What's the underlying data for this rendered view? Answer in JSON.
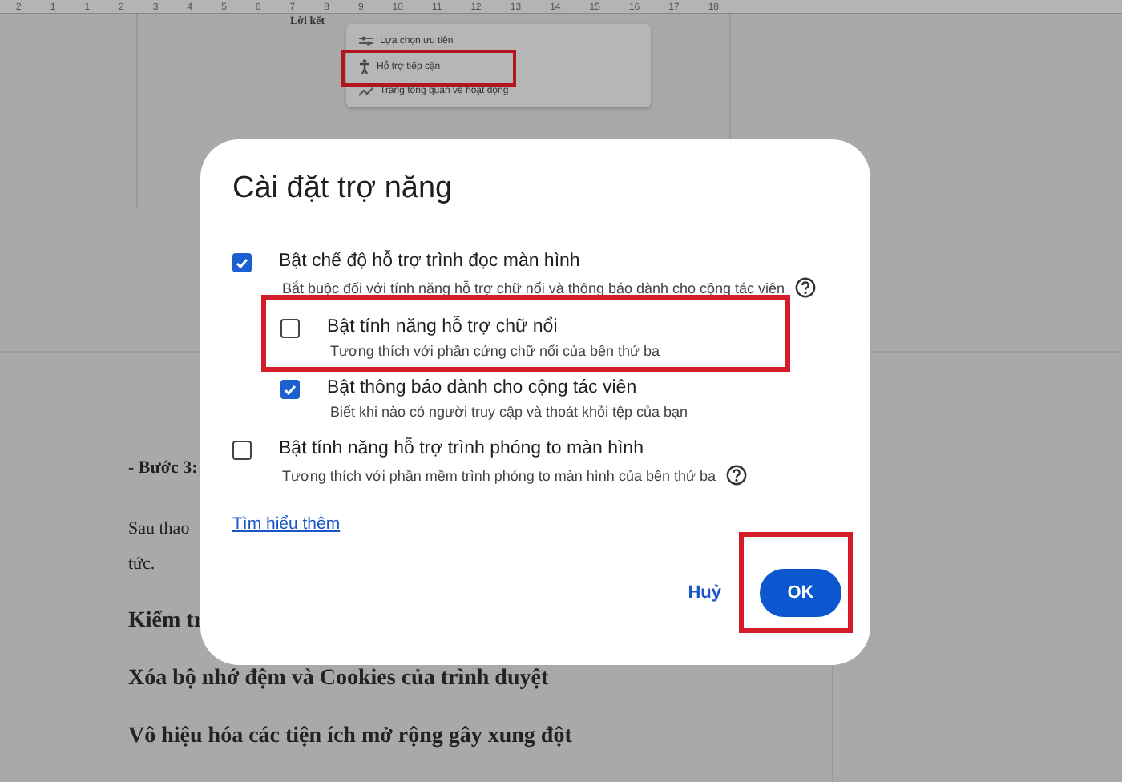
{
  "ruler": {
    "numbers": [
      "2",
      "1",
      "1",
      "2",
      "3",
      "4",
      "5",
      "6",
      "7",
      "8",
      "9",
      "10",
      "11",
      "12",
      "13",
      "14",
      "15",
      "16",
      "17",
      "18"
    ]
  },
  "menu_card": {
    "heading": "Lời kết",
    "items": [
      {
        "label": "Lựa chọn ưu tiên",
        "kind": "prefs",
        "highlighted": false
      },
      {
        "label": "Hỗ trợ tiếp cận",
        "kind": "access",
        "highlighted": true
      },
      {
        "label": "Trang tổng quan về hoạt động",
        "kind": "activity",
        "highlighted": false
      }
    ]
  },
  "document": {
    "paragraphs": [
      {
        "text": "- Bước 3:",
        "kind": "step"
      },
      {
        "text": "Sau thao",
        "kind": "body"
      },
      {
        "text": "tức.",
        "kind": "body"
      },
      {
        "text": "Kiểm tr",
        "kind": "heading"
      },
      {
        "text": "Xóa bộ nhớ đệm và Cookies của trình duyệt",
        "kind": "heading"
      },
      {
        "text": "Vô hiệu hóa các tiện ích mở rộng gây xung đột",
        "kind": "heading"
      }
    ]
  },
  "dialog": {
    "title": "Cài đặt trợ năng",
    "options": [
      {
        "label": "Bật chế độ hỗ trợ trình đọc màn hình",
        "description": "Bắt buộc đối với tính năng hỗ trợ chữ nổi và thông báo dành cho cộng tác viên",
        "checked": true,
        "help": true,
        "highlighted": false,
        "children": [
          {
            "label": "Bật tính năng hỗ trợ chữ nổi",
            "description": "Tương thích với phần cứng chữ nổi của bên thứ ba",
            "checked": false,
            "help": false,
            "highlighted": true
          },
          {
            "label": "Bật thông báo dành cho cộng tác viên",
            "description": "Biết khi nào có người truy cập và thoát khỏi tệp của bạn",
            "checked": true,
            "help": false,
            "highlighted": false
          }
        ]
      },
      {
        "label": "Bật tính năng hỗ trợ trình phóng to màn hình",
        "description": "Tương thích với phần mềm trình phóng to màn hình của bên thứ ba",
        "checked": false,
        "help": true,
        "highlighted": false
      }
    ],
    "link": "Tìm hiểu thêm",
    "buttons": [
      {
        "label": "Huỷ",
        "kind": "text",
        "highlighted": false
      },
      {
        "label": "OK",
        "kind": "filled",
        "highlighted": true
      }
    ]
  }
}
